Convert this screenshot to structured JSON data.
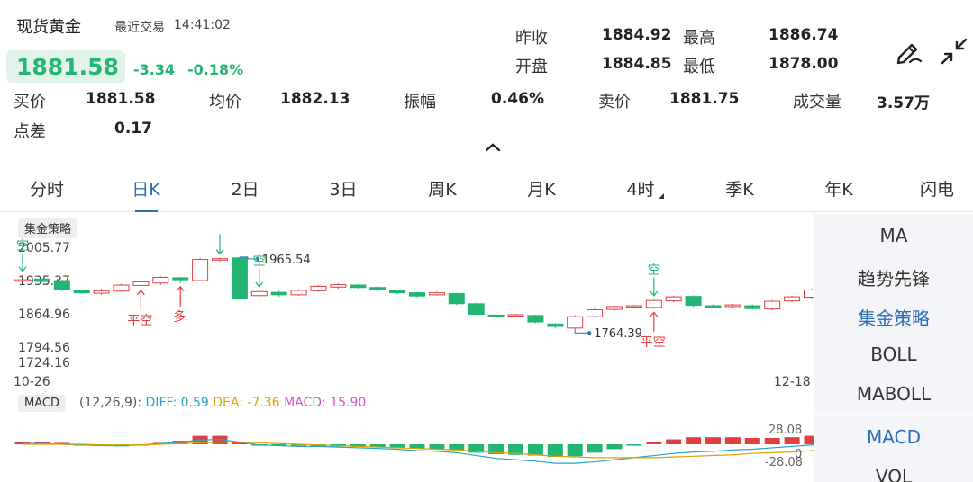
{
  "header": {
    "title": "现货黄金",
    "recent_label": "最近交易",
    "recent_time": "14:41:02",
    "price": "1881.58",
    "change": "-3.34",
    "change_pct": "-0.18%"
  },
  "stats": {
    "prev_close_label": "昨收",
    "prev_close": "1884.92",
    "high_label": "最高",
    "high": "1886.74",
    "open_label": "开盘",
    "open": "1884.85",
    "low_label": "最低",
    "low": "1878.00",
    "bid_label": "买价",
    "bid": "1881.58",
    "avg_label": "均价",
    "avg": "1882.13",
    "amplitude_label": "振幅",
    "amplitude": "0.46%",
    "ask_label": "卖价",
    "ask": "1881.75",
    "volume_label": "成交量",
    "volume": "3.57万",
    "spread_label": "点差",
    "spread": "0.17"
  },
  "tabs": [
    "分时",
    "日K",
    "2日",
    "3日",
    "周K",
    "月K",
    "4时",
    "季K",
    "年K",
    "闪电"
  ],
  "active_tab": "日K",
  "chart": {
    "strategy_badge": "集金策略",
    "y_labels": [
      "2005.77",
      "1935.37",
      "1864.96",
      "1794.56",
      "1724.16"
    ],
    "date_start": "10-26",
    "date_end": "12-18",
    "max_label": "1965.54",
    "min_label": "1764.39",
    "signals": {
      "short": "空",
      "close_short": "平空",
      "long": "多"
    }
  },
  "macd": {
    "badge": "MACD",
    "params": "(12,26,9):",
    "diff": "DIFF: 0.59",
    "dea": "DEA: -7.36",
    "macd": "MACD: 15.90",
    "axis_top": "28.08",
    "axis_zero": "0",
    "axis_bottom": "-28.08"
  },
  "indicators": {
    "main": [
      "MA",
      "趋势先锋",
      "集金策略",
      "BOLL",
      "MABOLL"
    ],
    "main_active": "集金策略",
    "sub": [
      "MACD",
      "VOL"
    ],
    "sub_active": "MACD"
  },
  "icons": [
    "draw-pen-icon",
    "collapse-arrows-icon",
    "chevron-up-icon"
  ],
  "colors": {
    "up": "#e04040",
    "down": "#22b573",
    "accent": "#2e6db3"
  },
  "chart_data": {
    "type": "candlestick",
    "x_range": [
      "10-26",
      "12-18"
    ],
    "ylim": [
      1724.16,
      2005.77
    ],
    "candles": [
      {
        "o": 1930,
        "c": 1930,
        "h": 1942,
        "l": 1925
      },
      {
        "o": 1932,
        "c": 1926,
        "h": 1934,
        "l": 1923
      },
      {
        "o": 1928,
        "c": 1905,
        "h": 1930,
        "l": 1902
      },
      {
        "o": 1903,
        "c": 1898,
        "h": 1906,
        "l": 1895
      },
      {
        "o": 1897,
        "c": 1903,
        "h": 1908,
        "l": 1893
      },
      {
        "o": 1902,
        "c": 1917,
        "h": 1920,
        "l": 1900
      },
      {
        "o": 1916,
        "c": 1925,
        "h": 1928,
        "l": 1913
      },
      {
        "o": 1922,
        "c": 1936,
        "h": 1939,
        "l": 1918
      },
      {
        "o": 1935,
        "c": 1930,
        "h": 1937,
        "l": 1922
      },
      {
        "o": 1928,
        "c": 1980,
        "h": 1984,
        "l": 1926
      },
      {
        "o": 1980,
        "c": 1982,
        "h": 1985,
        "l": 1975
      },
      {
        "o": 1984,
        "c": 1884,
        "h": 1986,
        "l": 1880
      },
      {
        "o": 1891,
        "c": 1901,
        "h": 1904,
        "l": 1888
      },
      {
        "o": 1899,
        "c": 1893,
        "h": 1903,
        "l": 1888
      },
      {
        "o": 1893,
        "c": 1904,
        "h": 1907,
        "l": 1890
      },
      {
        "o": 1903,
        "c": 1914,
        "h": 1917,
        "l": 1900
      },
      {
        "o": 1912,
        "c": 1918,
        "h": 1921,
        "l": 1908
      },
      {
        "o": 1917,
        "c": 1911,
        "h": 1919,
        "l": 1908
      },
      {
        "o": 1911,
        "c": 1905,
        "h": 1914,
        "l": 1902
      },
      {
        "o": 1903,
        "c": 1898,
        "h": 1905,
        "l": 1894
      },
      {
        "o": 1898,
        "c": 1890,
        "h": 1900,
        "l": 1886
      },
      {
        "o": 1893,
        "c": 1898,
        "h": 1901,
        "l": 1891
      },
      {
        "o": 1896,
        "c": 1871,
        "h": 1898,
        "l": 1868
      },
      {
        "o": 1871,
        "c": 1845,
        "h": 1873,
        "l": 1843
      },
      {
        "o": 1843,
        "c": 1841,
        "h": 1845,
        "l": 1838
      },
      {
        "o": 1841,
        "c": 1844,
        "h": 1846,
        "l": 1838
      },
      {
        "o": 1842,
        "c": 1826,
        "h": 1844,
        "l": 1823
      },
      {
        "o": 1821,
        "c": 1815,
        "h": 1823,
        "l": 1811
      },
      {
        "o": 1811,
        "c": 1839,
        "h": 1842,
        "l": 1808
      },
      {
        "o": 1839,
        "c": 1856,
        "h": 1859,
        "l": 1836
      },
      {
        "o": 1857,
        "c": 1864,
        "h": 1866,
        "l": 1853
      },
      {
        "o": 1863,
        "c": 1866,
        "h": 1868,
        "l": 1860
      },
      {
        "o": 1862,
        "c": 1879,
        "h": 1882,
        "l": 1859
      },
      {
        "o": 1878,
        "c": 1888,
        "h": 1891,
        "l": 1875
      },
      {
        "o": 1889,
        "c": 1867,
        "h": 1892,
        "l": 1863
      },
      {
        "o": 1866,
        "c": 1865,
        "h": 1869,
        "l": 1862
      },
      {
        "o": 1864,
        "c": 1868,
        "h": 1871,
        "l": 1861
      },
      {
        "o": 1866,
        "c": 1859,
        "h": 1869,
        "l": 1857
      },
      {
        "o": 1858,
        "c": 1877,
        "h": 1880,
        "l": 1855
      },
      {
        "o": 1878,
        "c": 1888,
        "h": 1891,
        "l": 1875
      },
      {
        "o": 1887,
        "c": 1905,
        "h": 1908,
        "l": 1884
      },
      {
        "o": 1904,
        "c": 1902,
        "h": 1907,
        "l": 1898
      }
    ],
    "macd_hist": [
      3,
      3,
      2,
      -1,
      -2,
      -3,
      -2,
      2,
      5,
      12,
      12,
      3,
      -2,
      -2,
      -2,
      -3,
      -3,
      -4,
      -4,
      -5,
      -6,
      -7,
      -8,
      -12,
      -14,
      -15,
      -16,
      -18,
      -17,
      -12,
      -7,
      -2,
      3,
      7,
      10,
      10,
      10,
      9,
      9,
      10,
      12,
      15
    ],
    "diff": [
      1,
      1,
      0,
      -1,
      -2,
      -2,
      -1,
      1,
      3,
      6,
      7,
      3,
      -1,
      -2,
      -3,
      -3,
      -4,
      -5,
      -6,
      -7,
      -9,
      -10,
      -12,
      -16,
      -20,
      -22,
      -24,
      -27,
      -27,
      -25,
      -22,
      -19,
      -16,
      -13,
      -11,
      -10,
      -8,
      -7,
      -5,
      -3,
      -1,
      0.59
    ],
    "dea": [
      0,
      0,
      0,
      0,
      -1,
      -1,
      -1,
      0,
      1,
      2,
      3,
      3,
      2,
      1,
      0,
      -1,
      -2,
      -3,
      -4,
      -5,
      -6,
      -7,
      -8,
      -10,
      -12,
      -13,
      -15,
      -17,
      -18,
      -19,
      -19,
      -19,
      -19,
      -18,
      -17,
      -16,
      -15,
      -13,
      -12,
      -11,
      -9,
      -7.36
    ],
    "macd_range": [
      -28.08,
      28.08
    ]
  }
}
